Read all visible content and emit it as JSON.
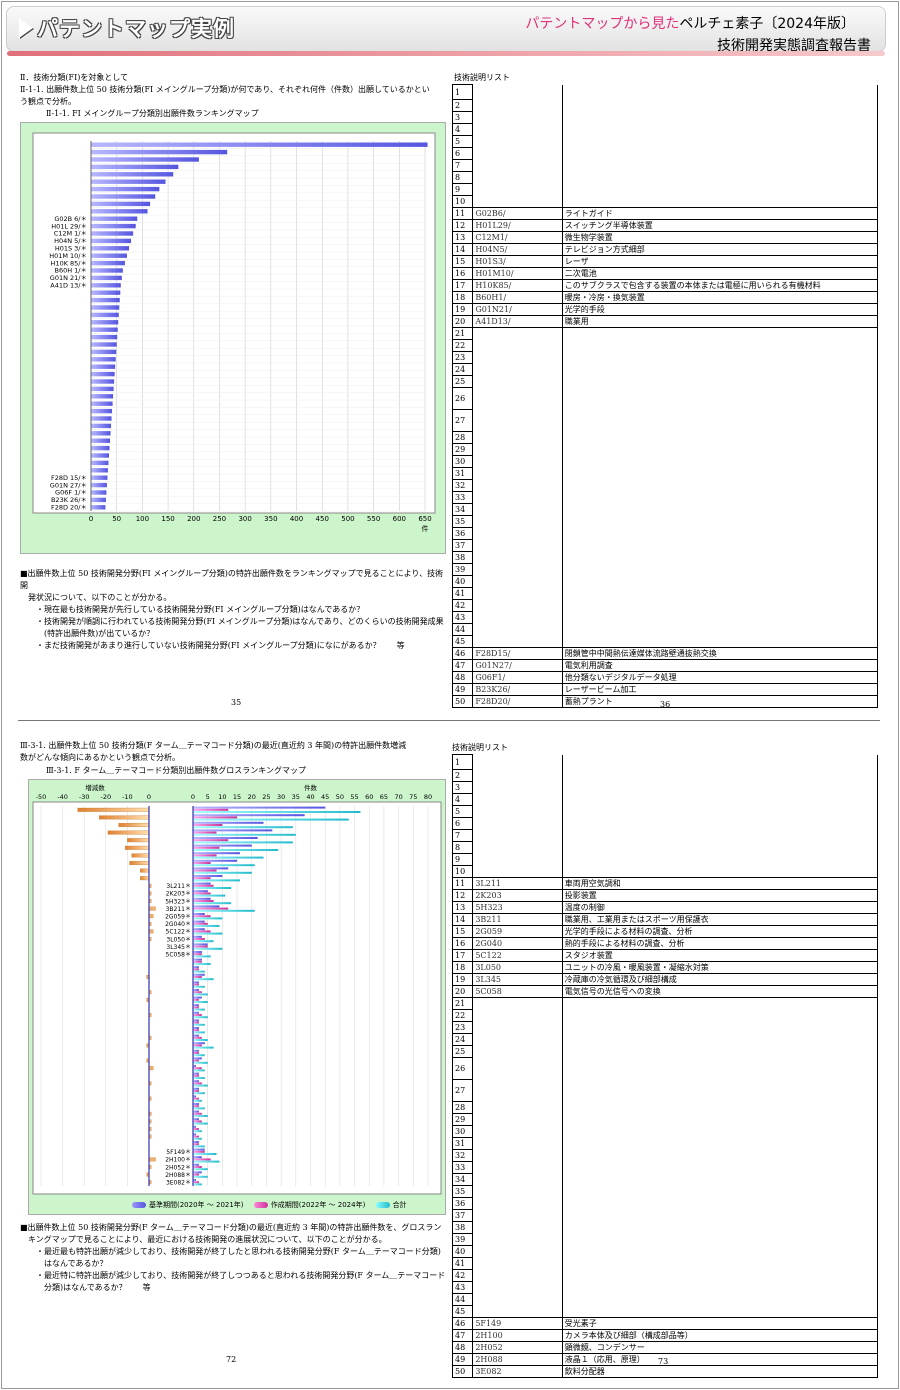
{
  "header": {
    "title": "パテントマップ実例",
    "right_pink": "パテントマップから見た",
    "right_black": "ペルチェ素子〔2024年版〕",
    "right_line2": "技術開発実態調査報告書"
  },
  "page1": {
    "section": "Ⅱ．技術分類(FI)を対象として",
    "heading_l1": "Ⅱ-1-1. 出願件数上位 50 技術分類(FI メイングループ分類)が何であり、それぞれ何件（件数）出願しているかとい",
    "heading_l2": "う観点で分析。",
    "chart_title": "Ⅱ-1-1. FI メイングループ分類別出願件数ランキングマップ",
    "axis_unit": "件",
    "notes": [
      "■出願件数上位 50 技術開発分野(FI メイングループ分類)の特許出願件数をランキングマップで見ることにより、技術開",
      "　発状況について、以下のことが分かる。",
      "　　・現在最も技術開発が先行している技術開発分野(FI メイングループ分類)はなんであるか？",
      "　　・技術開発が順調に行われている技術開発分野(FI メイングループ分類)はなんであり、どのくらいの技術開発成果",
      "　　　(特許出願件数)が出ているか？",
      "　　・まだ技術開発があまり進行していない技術開発分野(FI メイングループ分類)になにがあるか？　　等"
    ],
    "page_left": "35",
    "page_right": "36",
    "list_title": "技術説明リスト"
  },
  "page2": {
    "heading_l1": "Ⅲ-3-1. 出願件数上位 50 技術分類(F ターム＿テーマコード分類)の最近(直近約 3 年間)の特許出願件数増減",
    "heading_l2": "数がどんな傾向にあるかという観点で分析。",
    "chart_title": "Ⅲ-3-1. F ターム＿テーマコード分類別出願件数グロスランキングマップ",
    "left_axis_label": "増減数",
    "right_axis_label": "件数",
    "legend": [
      "基準期間(2020年 ～ 2021年)",
      "作成期間(2022年 ～ 2024年)",
      "合計"
    ],
    "notes": [
      "■出願件数上位 50 技術開発分野(F ターム＿テーマコード分類)の最近(直近約 3 年間)の特許出願件数を、グロスラン",
      "　キングマップで見ることにより、最近における技術開発の進展状況について、以下のことが分かる。",
      "　　・最近最も特許出願が減少しており、技術開発が終了したと思われる技術開発分野(F ターム＿テーマコード分類)",
      "　　　はなんであるか？",
      "　　・最近特に特許出願が減少しており、技術開発が終了しつつあると思われる技術開発分野(F ターム＿テーマコード",
      "　　　分類)はなんであるか？　　等"
    ],
    "page_left": "72",
    "page_right": "73",
    "list_title": "技術説明リスト"
  },
  "colors": {
    "accent_pink": "#e0307a",
    "bar_blue": "#7c7cf0",
    "bar_pink": "#e060c0",
    "bar_cyan": "#40d8e0",
    "bar_orange": "#f0a050",
    "chart_bg": "#ccf5cc"
  },
  "chart_data": [
    {
      "type": "bar",
      "orientation": "horizontal",
      "title": "Ⅱ-1-1. FI メイングループ分類別出願件数ランキングマップ",
      "xlabel": "件",
      "xlim": [
        0,
        650
      ],
      "xticks": [
        0,
        50,
        100,
        150,
        200,
        250,
        300,
        350,
        400,
        450,
        500,
        550,
        600,
        650
      ],
      "labels": [
        "",
        "",
        "",
        "",
        "",
        "",
        "",
        "",
        "",
        "",
        "G02B 6/＊",
        "H01L 29/＊",
        "C12M 1/＊",
        "H04N 5/＊",
        "H01S 3/＊",
        "H01M 10/＊",
        "H10K 85/＊",
        "B60H 1/＊",
        "G01N 21/＊",
        "A41D 13/＊",
        "",
        "",
        "",
        "",
        "",
        "",
        "",
        "",
        "",
        "",
        "",
        "",
        "",
        "",
        "",
        "",
        "",
        "",
        "",
        "",
        "",
        "",
        "",
        "",
        "",
        "F28D 15/＊",
        "G01N 27/＊",
        "G06F 1/＊",
        "B23K 26/＊",
        "F28D 20/＊"
      ],
      "values": [
        655,
        265,
        210,
        170,
        160,
        145,
        133,
        125,
        115,
        110,
        90,
        87,
        82,
        78,
        74,
        70,
        66,
        62,
        60,
        58,
        57,
        56,
        55,
        54,
        53,
        52,
        51,
        50,
        49,
        48,
        47,
        46,
        45,
        44,
        43,
        42,
        41,
        40,
        39,
        38,
        37,
        36,
        35,
        34,
        33,
        32,
        31,
        30,
        29,
        28
      ]
    },
    {
      "type": "bar",
      "orientation": "horizontal",
      "title": "Ⅲ-3-1. F ターム＿テーマコード分類別出願件数グロスランキングマップ",
      "xlabel_left": "増減数",
      "xlabel_right": "件数",
      "xlim_left": [
        -50,
        0
      ],
      "xticks_left": [
        -50,
        -40,
        -30,
        -20,
        -10,
        0
      ],
      "xlim_right": [
        0,
        80
      ],
      "xticks_right": [
        0,
        5,
        10,
        15,
        20,
        25,
        30,
        35,
        40,
        45,
        50,
        55,
        60,
        65,
        70,
        75,
        80
      ],
      "labels": [
        "",
        "",
        "",
        "",
        "",
        "",
        "",
        "",
        "",
        "",
        "3L211＊",
        "2K203＊",
        "5H323＊",
        "3B211＊",
        "2G059＊",
        "2G040＊",
        "5C122＊",
        "3L050＊",
        "3L345＊",
        "5C058＊",
        "",
        "",
        "",
        "",
        "",
        "",
        "",
        "",
        "",
        "",
        "",
        "",
        "",
        "",
        "",
        "",
        "",
        "",
        "",
        "",
        "",
        "",
        "",
        "",
        "",
        "5F149＊",
        "2H100＊",
        "2H052＊",
        "2H088＊",
        "3E082＊"
      ],
      "series": [
        {
          "name": "基準期間(2020年 ～ 2021年)",
          "values": [
            45,
            38,
            24,
            27,
            22,
            20,
            16,
            15,
            12,
            10,
            6,
            5,
            6,
            9,
            4,
            4,
            4,
            3,
            5,
            3,
            3,
            2,
            4,
            2,
            2,
            3,
            2,
            2,
            2,
            2,
            2,
            4,
            2,
            3,
            1,
            2,
            2,
            2,
            1,
            2,
            2,
            2,
            1,
            1,
            2,
            4,
            3,
            2,
            3,
            1
          ]
        },
        {
          "name": "作成期間(2022年 ～ 2024年)",
          "values": [
            12,
            15,
            10,
            8,
            12,
            9,
            8,
            6,
            8,
            6,
            7,
            6,
            7,
            12,
            6,
            5,
            6,
            4,
            5,
            3,
            3,
            2,
            3,
            2,
            3,
            2,
            2,
            3,
            2,
            2,
            3,
            3,
            2,
            2,
            3,
            2,
            3,
            2,
            2,
            2,
            3,
            3,
            2,
            2,
            2,
            4,
            6,
            3,
            2,
            2
          ]
        },
        {
          "name": "合計",
          "values": [
            57,
            53,
            34,
            35,
            34,
            29,
            24,
            21,
            20,
            16,
            13,
            11,
            13,
            21,
            10,
            9,
            10,
            7,
            10,
            6,
            6,
            4,
            7,
            4,
            5,
            5,
            4,
            5,
            4,
            4,
            5,
            7,
            4,
            5,
            4,
            4,
            5,
            4,
            3,
            4,
            5,
            5,
            3,
            3,
            4,
            8,
            9,
            5,
            5,
            3
          ]
        }
      ],
      "diff": [
        -33,
        -23,
        -14,
        -19,
        -10,
        -11,
        -8,
        -9,
        -4,
        -4,
        1,
        1,
        1,
        3,
        2,
        1,
        2,
        1,
        0,
        0,
        0,
        0,
        -1,
        0,
        1,
        -1,
        0,
        1,
        0,
        0,
        1,
        -1,
        0,
        -1,
        2,
        0,
        1,
        0,
        1,
        0,
        1,
        1,
        1,
        1,
        0,
        0,
        3,
        1,
        -1,
        1
      ]
    }
  ],
  "list1": [
    {
      "n": "1",
      "code": "",
      "desc": ""
    },
    {
      "n": "2",
      "code": "",
      "desc": ""
    },
    {
      "n": "3",
      "code": "",
      "desc": ""
    },
    {
      "n": "4",
      "code": "",
      "desc": ""
    },
    {
      "n": "5",
      "code": "",
      "desc": ""
    },
    {
      "n": "6",
      "code": "",
      "desc": ""
    },
    {
      "n": "7",
      "code": "",
      "desc": ""
    },
    {
      "n": "8",
      "code": "",
      "desc": ""
    },
    {
      "n": "9",
      "code": "",
      "desc": ""
    },
    {
      "n": "10",
      "code": "",
      "desc": ""
    },
    {
      "n": "11",
      "code": "G02B6/",
      "desc": "ライトガイド"
    },
    {
      "n": "12",
      "code": "H01L29/",
      "desc": "スイッチング半導体装置"
    },
    {
      "n": "13",
      "code": "C12M1/",
      "desc": "微生物学装置"
    },
    {
      "n": "14",
      "code": "H04N5/",
      "desc": "テレビジョン方式細部"
    },
    {
      "n": "15",
      "code": "H01S3/",
      "desc": "レーザ"
    },
    {
      "n": "16",
      "code": "H01M10/",
      "desc": "二次電池"
    },
    {
      "n": "17",
      "code": "H10K85/",
      "desc": "このサブクラスで包含する装置の本体または電極に用いられる有機材料"
    },
    {
      "n": "18",
      "code": "B60H1/",
      "desc": "暖房・冷房・換気装置"
    },
    {
      "n": "19",
      "code": "G01N21/",
      "desc": "光学的手段"
    },
    {
      "n": "20",
      "code": "A41D13/",
      "desc": "職業用"
    },
    {
      "n": "21",
      "code": "",
      "desc": ""
    },
    {
      "n": "22",
      "code": "",
      "desc": ""
    },
    {
      "n": "23",
      "code": "",
      "desc": ""
    },
    {
      "n": "24",
      "code": "",
      "desc": ""
    },
    {
      "n": "25",
      "code": "",
      "desc": ""
    },
    {
      "n": "26",
      "code": "",
      "desc": ""
    },
    {
      "n": "27",
      "code": "",
      "desc": ""
    },
    {
      "n": "28",
      "code": "",
      "desc": ""
    },
    {
      "n": "29",
      "code": "",
      "desc": ""
    },
    {
      "n": "30",
      "code": "",
      "desc": ""
    },
    {
      "n": "31",
      "code": "",
      "desc": ""
    },
    {
      "n": "32",
      "code": "",
      "desc": ""
    },
    {
      "n": "33",
      "code": "",
      "desc": ""
    },
    {
      "n": "34",
      "code": "",
      "desc": ""
    },
    {
      "n": "35",
      "code": "",
      "desc": ""
    },
    {
      "n": "36",
      "code": "",
      "desc": ""
    },
    {
      "n": "37",
      "code": "",
      "desc": ""
    },
    {
      "n": "38",
      "code": "",
      "desc": ""
    },
    {
      "n": "39",
      "code": "",
      "desc": ""
    },
    {
      "n": "40",
      "code": "",
      "desc": ""
    },
    {
      "n": "41",
      "code": "",
      "desc": ""
    },
    {
      "n": "42",
      "code": "",
      "desc": ""
    },
    {
      "n": "43",
      "code": "",
      "desc": ""
    },
    {
      "n": "44",
      "code": "",
      "desc": ""
    },
    {
      "n": "45",
      "code": "",
      "desc": ""
    },
    {
      "n": "46",
      "code": "F28D15/",
      "desc": "閉鎖管中中間熱伝達媒体流路壁通抜熱交換"
    },
    {
      "n": "47",
      "code": "G01N27/",
      "desc": "電気利用調査"
    },
    {
      "n": "48",
      "code": "G06F1/",
      "desc": "他分類ないデジタルデータ処理"
    },
    {
      "n": "49",
      "code": "B23K26/",
      "desc": "レーザービーム加工"
    },
    {
      "n": "50",
      "code": "F28D20/",
      "desc": "蓄熱プラント"
    }
  ],
  "list2": [
    {
      "n": "1",
      "code": "",
      "desc": ""
    },
    {
      "n": "2",
      "code": "",
      "desc": ""
    },
    {
      "n": "3",
      "code": "",
      "desc": ""
    },
    {
      "n": "4",
      "code": "",
      "desc": ""
    },
    {
      "n": "5",
      "code": "",
      "desc": ""
    },
    {
      "n": "6",
      "code": "",
      "desc": ""
    },
    {
      "n": "7",
      "code": "",
      "desc": ""
    },
    {
      "n": "8",
      "code": "",
      "desc": ""
    },
    {
      "n": "9",
      "code": "",
      "desc": ""
    },
    {
      "n": "10",
      "code": "",
      "desc": ""
    },
    {
      "n": "11",
      "code": "3L211",
      "desc": "車両用空気調和"
    },
    {
      "n": "12",
      "code": "2K203",
      "desc": "投影装置"
    },
    {
      "n": "13",
      "code": "5H323",
      "desc": "温度の制御"
    },
    {
      "n": "14",
      "code": "3B211",
      "desc": "職業用、工業用またはスポーツ用保護衣"
    },
    {
      "n": "15",
      "code": "2G059",
      "desc": "光学的手段による材料の調査、分析"
    },
    {
      "n": "16",
      "code": "2G040",
      "desc": "熱的手段による材料の調査、分析"
    },
    {
      "n": "17",
      "code": "5C122",
      "desc": "スタジオ装置"
    },
    {
      "n": "18",
      "code": "3L050",
      "desc": "ユニットの冷風・暖風装置・凝縮水対策"
    },
    {
      "n": "19",
      "code": "3L345",
      "desc": "冷蔵庫の冷気循環及び細部構成"
    },
    {
      "n": "20",
      "code": "5C058",
      "desc": "電気信号の光信号への変換"
    },
    {
      "n": "21",
      "code": "",
      "desc": ""
    },
    {
      "n": "22",
      "code": "",
      "desc": ""
    },
    {
      "n": "23",
      "code": "",
      "desc": ""
    },
    {
      "n": "24",
      "code": "",
      "desc": ""
    },
    {
      "n": "25",
      "code": "",
      "desc": ""
    },
    {
      "n": "26",
      "code": "",
      "desc": ""
    },
    {
      "n": "27",
      "code": "",
      "desc": ""
    },
    {
      "n": "28",
      "code": "",
      "desc": ""
    },
    {
      "n": "29",
      "code": "",
      "desc": ""
    },
    {
      "n": "30",
      "code": "",
      "desc": ""
    },
    {
      "n": "31",
      "code": "",
      "desc": ""
    },
    {
      "n": "32",
      "code": "",
      "desc": ""
    },
    {
      "n": "33",
      "code": "",
      "desc": ""
    },
    {
      "n": "34",
      "code": "",
      "desc": ""
    },
    {
      "n": "35",
      "code": "",
      "desc": ""
    },
    {
      "n": "36",
      "code": "",
      "desc": ""
    },
    {
      "n": "37",
      "code": "",
      "desc": ""
    },
    {
      "n": "38",
      "code": "",
      "desc": ""
    },
    {
      "n": "39",
      "code": "",
      "desc": ""
    },
    {
      "n": "40",
      "code": "",
      "desc": ""
    },
    {
      "n": "41",
      "code": "",
      "desc": ""
    },
    {
      "n": "42",
      "code": "",
      "desc": ""
    },
    {
      "n": "43",
      "code": "",
      "desc": ""
    },
    {
      "n": "44",
      "code": "",
      "desc": ""
    },
    {
      "n": "45",
      "code": "",
      "desc": ""
    },
    {
      "n": "46",
      "code": "5F149",
      "desc": "受光素子"
    },
    {
      "n": "47",
      "code": "2H100",
      "desc": "カメラ本体及び細部（構成部品等）"
    },
    {
      "n": "48",
      "code": "2H052",
      "desc": "顕微鏡、コンデンサー"
    },
    {
      "n": "49",
      "code": "2H088",
      "desc": "液晶１（応用、原理）"
    },
    {
      "n": "50",
      "code": "3E082",
      "desc": "飲料分配器"
    }
  ]
}
